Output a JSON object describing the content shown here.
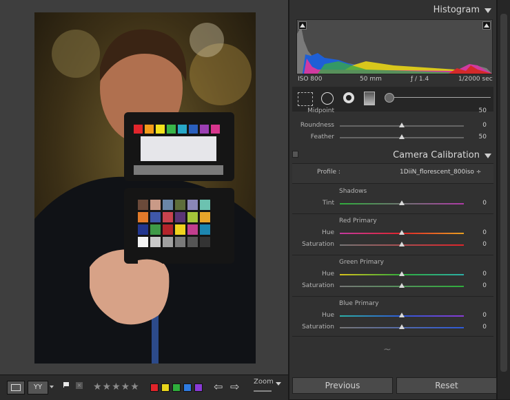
{
  "histogram": {
    "title": "Histogram",
    "iso": "ISO 800",
    "focal": "50 mm",
    "aperture": "ƒ / 1.4",
    "shutter": "1/2000 sec"
  },
  "tone_curve": {
    "cut_label": "Midpoint",
    "cut_value": "50",
    "roundness_label": "Roundness",
    "roundness_value": "0",
    "feather_label": "Feather",
    "feather_value": "50"
  },
  "calibration": {
    "title": "Camera Calibration",
    "profile_label": "Profile :",
    "profile_value": "1DiiN_florescent_800iso ÷",
    "shadows": {
      "title": "Shadows",
      "tint_label": "Tint",
      "tint_value": "0"
    },
    "red": {
      "title": "Red Primary",
      "hue_label": "Hue",
      "hue_value": "0",
      "sat_label": "Saturation",
      "sat_value": "0"
    },
    "green": {
      "title": "Green Primary",
      "hue_label": "Hue",
      "hue_value": "0",
      "sat_label": "Saturation",
      "sat_value": "0"
    },
    "blue": {
      "title": "Blue Primary",
      "hue_label": "Hue",
      "hue_value": "0",
      "sat_label": "Saturation",
      "sat_value": "0"
    }
  },
  "buttons": {
    "previous": "Previous",
    "reset": "Reset"
  },
  "toolbar": {
    "stars": "★★★★★",
    "zoom": "Zoom"
  },
  "colors": {
    "accent_red": "#e0242a",
    "accent_yellow": "#e8d51c",
    "accent_green": "#2fae3c",
    "accent_blue": "#2e7be0",
    "accent_purple": "#8a3ad6"
  }
}
